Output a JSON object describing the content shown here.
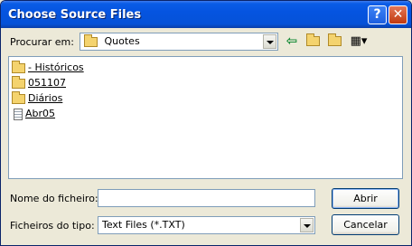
{
  "window": {
    "title": "Choose Source Files",
    "help_glyph": "?",
    "close_glyph": "✕"
  },
  "lookin": {
    "label": "Procurar em:",
    "value": "Quotes"
  },
  "toolbar": {
    "back_glyph": "⇦",
    "up_glyph": "⇧",
    "newfolder_glyph": "✱",
    "views_glyph": "▦▾"
  },
  "files": [
    {
      "name": "- Históricos",
      "type": "folder"
    },
    {
      "name": "051107",
      "type": "folder"
    },
    {
      "name": "Diários",
      "type": "folder"
    },
    {
      "name": "Abr05",
      "type": "file"
    }
  ],
  "filename": {
    "label": "Nome do ficheiro:",
    "value": ""
  },
  "filetype": {
    "label": "Ficheiros do tipo:",
    "value": "Text Files (*.TXT)"
  },
  "buttons": {
    "open": "Abrir",
    "cancel": "Cancelar"
  }
}
